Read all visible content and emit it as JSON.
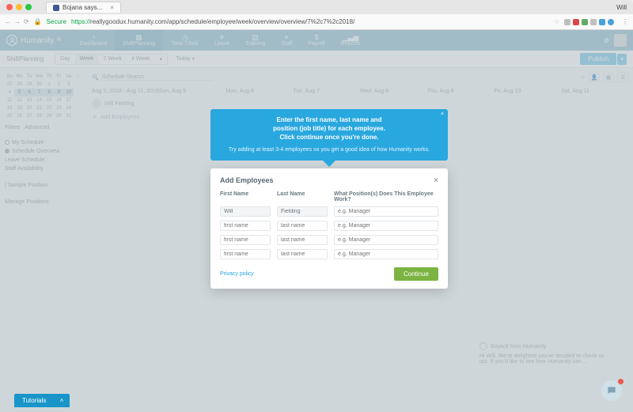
{
  "browser": {
    "tab_title": "Bojana says...",
    "user_label": "Will",
    "secure_label": "Secure",
    "url_prefix": "https://",
    "url_rest": "reallygoodux.humanity.com/app/schedule/employee/week/overview/overview/7%2c7%2c2018/"
  },
  "app": {
    "brand": "Humanity",
    "nav": [
      {
        "label": "Dashboard"
      },
      {
        "label": "ShiftPlanning"
      },
      {
        "label": "Time Clock"
      },
      {
        "label": "Leave"
      },
      {
        "label": "Training"
      },
      {
        "label": "Staff"
      },
      {
        "label": "Payroll"
      },
      {
        "label": "Reports"
      }
    ],
    "toolbar": {
      "title": "ShiftPlanning",
      "ranges": [
        "Day",
        "Week",
        "2 Week",
        "4 Week"
      ],
      "today": "Today",
      "publish": "Publish"
    },
    "mini_cal": {
      "dow": [
        "Su",
        "Mo",
        "Tu",
        "We",
        "Th",
        "Fr",
        "Sa"
      ],
      "weeks": [
        [
          "27",
          "28",
          "29",
          "30",
          "1",
          "2",
          "3"
        ],
        [
          "4",
          "5",
          "6",
          "7",
          "8",
          "9",
          "10"
        ],
        [
          "11",
          "12",
          "13",
          "14",
          "15",
          "16",
          "17"
        ],
        [
          "18",
          "19",
          "20",
          "21",
          "22",
          "23",
          "24"
        ],
        [
          "25",
          "26",
          "27",
          "28",
          "29",
          "30",
          "31"
        ]
      ],
      "current_row": 2
    },
    "left": {
      "filters": "Filters",
      "advanced": "Advanced",
      "my_schedule": "My Schedule",
      "schedule_overview": "Schedule Overview",
      "leave_schedule": "Leave Schedule",
      "staff_availability": "Staff Availability",
      "sample_position": "| Sample Position",
      "manage_positions": "Manage Positions"
    },
    "main": {
      "search_placeholder": "Schedule Search",
      "range_label": "Aug 5, 2018 - Aug 11, 2018",
      "days": [
        "Sun, Aug 5",
        "Mon, Aug 6",
        "Tue, Aug 7",
        "Wed, Aug 8",
        "Thu, Aug 9",
        "Fri, Aug 10",
        "Sat, Aug 11"
      ],
      "employee_name": "Will Fielding",
      "add_employees_link": "Add Employees"
    },
    "boyack": {
      "name": "Boyack from Humanity",
      "text": "Hi Will, We're delighted you've decided to check us out. If you'd like to see how Humanity can…"
    }
  },
  "callout": {
    "line1": "Enter the first name, last name and",
    "line2": "position (job title) for each employee.",
    "line3": "Click continue once you're done.",
    "sub": "Try adding at least 3-4 employees so you get a good idea of how Humanity works."
  },
  "modal": {
    "title": "Add Employees",
    "col1": "First Name",
    "col2": "Last Name",
    "col3": "What Position(s) Does This Employee Work?",
    "rows": [
      {
        "first": "Will",
        "last": "Fielding",
        "pos": ""
      },
      {
        "first": "",
        "last": "",
        "pos": ""
      },
      {
        "first": "",
        "last": "",
        "pos": ""
      },
      {
        "first": "",
        "last": "",
        "pos": ""
      }
    ],
    "placeholders": {
      "first": "first name",
      "last": "last name",
      "pos": "e.g. Manager"
    },
    "privacy": "Privacy policy",
    "continue": "Continue"
  },
  "tutorials_label": "Tutorials"
}
